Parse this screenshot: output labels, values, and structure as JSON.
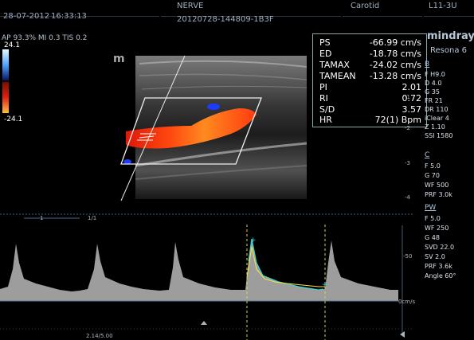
{
  "header": {
    "date": "28-07-2012",
    "time": "16:33:13",
    "exam": "NERVE",
    "patient_id": "20120728-144809-1B3F",
    "preset": "Carotid",
    "probe": "L11-3U"
  },
  "top_left": {
    "indices": "AP 93.3% MI 0.3 TIS 0.2",
    "scale_top": "24.1",
    "scale_bottom": "-24.1"
  },
  "brand": {
    "logo": "mindray",
    "model": "Resona 6",
    "mark": "m"
  },
  "measurements": [
    {
      "label": "PS",
      "value": "-66.99 cm/s"
    },
    {
      "label": "ED",
      "value": "-18.78 cm/s"
    },
    {
      "label": "TAMAX",
      "value": "-24.02 cm/s"
    },
    {
      "label": "TAMEAN",
      "value": "-13.28 cm/s"
    },
    {
      "label": "PI",
      "value": "2.01"
    },
    {
      "label": "RI",
      "value": "0.72"
    },
    {
      "label": "S/D",
      "value": "3.57"
    },
    {
      "label": "HR",
      "value": "72(1) Bpm"
    }
  ],
  "b_mode": {
    "title": "B",
    "params": [
      "F H9.0",
      "D 4.0",
      "G 35",
      "FR 21",
      "DR 110",
      "iClear 4",
      "Z 1.10",
      "SSI 1580"
    ]
  },
  "color_mode": {
    "title": "C",
    "params": [
      "F 5.0",
      "G 70",
      "WF 500",
      "PRF 3.0k"
    ]
  },
  "pw_mode": {
    "title": "PW",
    "params": [
      "F 5.0",
      "WF 250",
      "G 48",
      "SVD 22.0",
      "SV 2.0",
      "PRF 3.6k",
      "Angle  60°"
    ]
  },
  "depth_scale": {
    "marks": [
      "-1",
      "-2",
      "-3",
      "-4"
    ]
  },
  "spectrum": {
    "scale_label": "-50",
    "baseline_label": "0cm/s",
    "speed_label": "1/1",
    "marker_label": "1",
    "time_label": "2.14/5.00"
  },
  "colors": {
    "flow_red": "#ff3a10",
    "flow_orange": "#ff7a18",
    "flow_blue": "#1b3cff",
    "trace_yellow": "#ffe040",
    "cursor_cyan": "#30d0d0",
    "text_blue": "#a9c4dd"
  }
}
